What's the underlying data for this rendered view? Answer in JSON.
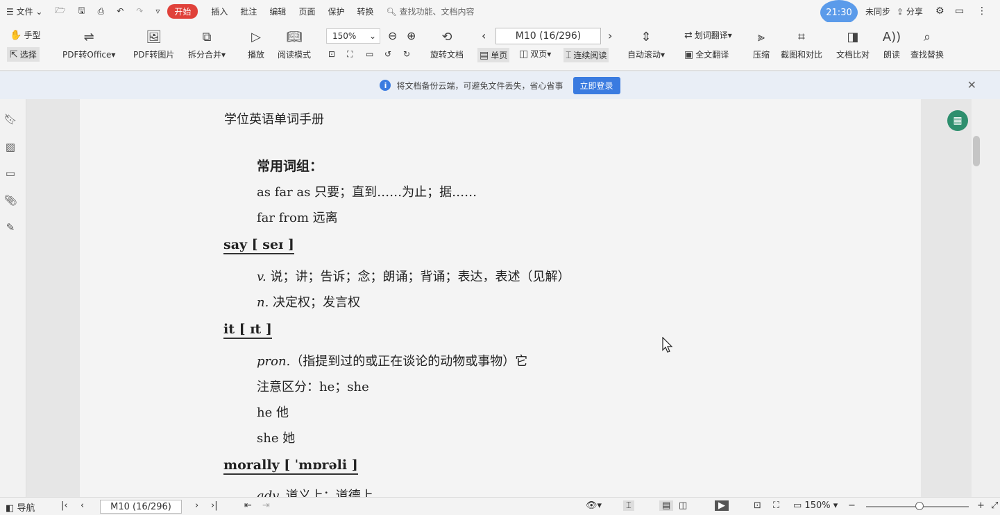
{
  "topbar": {
    "menu": "文件",
    "tabs": [
      "开始",
      "插入",
      "批注",
      "编辑",
      "页面",
      "保护",
      "转换"
    ],
    "active_tab": "开始",
    "search_placeholder": "查找功能、文档内容",
    "time": "21:30",
    "sync": "未同步",
    "share": "分享"
  },
  "ribbon": {
    "hand": "手型",
    "select": "选择",
    "pdf_to_office": "PDF转Office",
    "pdf_to_image": "PDF转图片",
    "split_merge": "拆分合并",
    "play": "播放",
    "read_mode": "阅读模式",
    "zoom": "150%",
    "rotate": "旋转文档",
    "page_box": "M10 (16/296)",
    "single_page": "单页",
    "double_page": "双页",
    "continuous": "连续阅读",
    "auto_scroll": "自动滚动",
    "word_translate": "划词翻译",
    "full_translate": "全文翻译",
    "compress": "压缩",
    "screenshot_compare": "截图和对比",
    "doc_compare": "文档比对",
    "read_aloud": "朗读",
    "find_replace": "查找替换"
  },
  "notice": {
    "text": "将文档备份云端，可避免文件丢失，省心省事",
    "login": "立即登录"
  },
  "doc": {
    "running_head": "学位英语单词手册",
    "section_title": "常用词组：",
    "phrases": [
      "as far as  只要；直到……为止；据……",
      "far from  远离"
    ],
    "entries": [
      {
        "headword": "say [ seɪ ]",
        "lines": [
          {
            "pos": "v.",
            "text": " 说；讲；告诉；念；朗诵；背诵；表达，表述（见解）"
          },
          {
            "pos": "n.",
            "text": " 决定权；发言权"
          }
        ]
      },
      {
        "headword": "it [ ɪt ]",
        "lines": [
          {
            "pos": "pron.",
            "text": "（指提到过的或正在谈论的动物或事物）它"
          },
          {
            "pos": "",
            "text": "注意区分：he；she"
          },
          {
            "pos": "",
            "text": "he  他"
          },
          {
            "pos": "",
            "text": "she  她"
          }
        ]
      },
      {
        "headword": "morally [ ˈmɒrəli ]",
        "lines": [
          {
            "pos": "adv.",
            "text": " 道义上；道德上"
          }
        ]
      }
    ]
  },
  "status": {
    "nav": "导航",
    "page": "M10 (16/296)",
    "zoom": "150%"
  }
}
